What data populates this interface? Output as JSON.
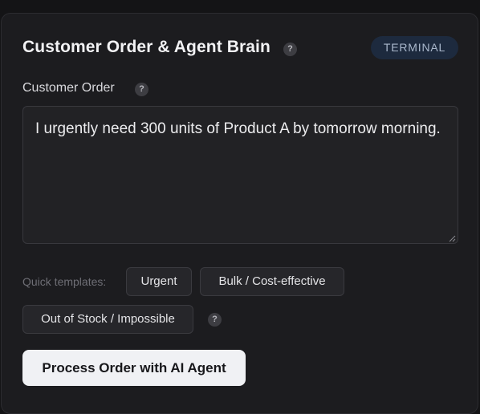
{
  "panel": {
    "title": "Customer Order & Agent Brain",
    "title_help_icon": "?",
    "badge": "TERMINAL"
  },
  "order_field": {
    "label": "Customer Order",
    "help_icon": "?",
    "value": "I urgently need 300 units of Product A by tomorrow morning."
  },
  "templates": {
    "label": "Quick templates:",
    "items": [
      "Urgent",
      "Bulk / Cost-effective",
      "Out of Stock / Impossible"
    ],
    "help_icon": "?"
  },
  "actions": {
    "process_label": "Process Order with AI Agent"
  },
  "colors": {
    "background": "#1c1c1f",
    "badge_bg": "#1d2a3e",
    "primary_button_bg": "#f0f1f4"
  },
  "icons": [
    "help-icon",
    "resize-grip-icon"
  ]
}
